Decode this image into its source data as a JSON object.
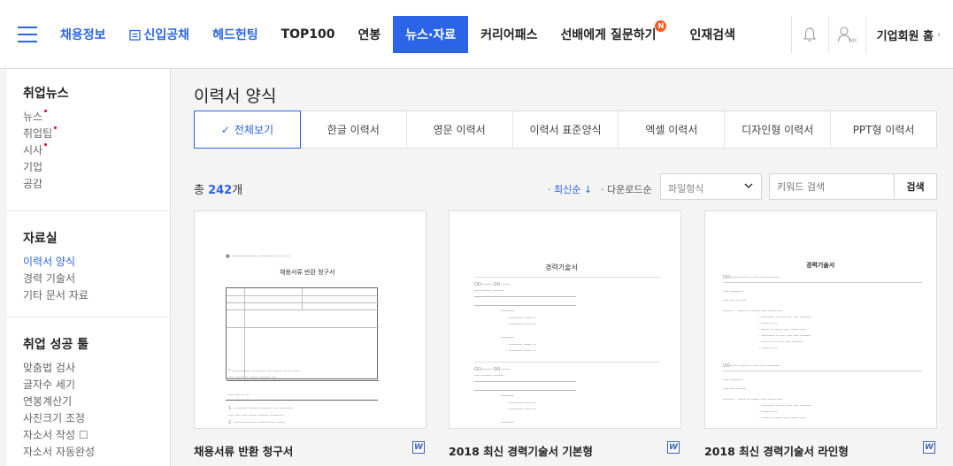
{
  "nav": {
    "items": [
      "채용정보",
      "신입공채",
      "헤드헌팅",
      "TOP100",
      "연봉",
      "뉴스·자료",
      "커리어패스",
      "선배에게 질문하기",
      "인재검색"
    ],
    "new_badge": "N",
    "corp_home": "기업회원 홈"
  },
  "sidebar": {
    "sections": [
      {
        "title": "취업뉴스",
        "items": [
          "뉴스",
          "취업팁",
          "시사",
          "기업",
          "공감"
        ]
      },
      {
        "title": "자료실",
        "items": [
          "이력서 양식",
          "경력 기술서",
          "기타 문서 자료"
        ]
      },
      {
        "title": "취업 성공 툴",
        "items": [
          "맞춤법 검사",
          "글자수 세기",
          "연봉계산기",
          "사진크기 조정",
          "자소서 작성 ☐",
          "자소서 자동완성"
        ]
      }
    ]
  },
  "main": {
    "title": "이력서 양식",
    "tabs": [
      "전체보기",
      "한글 이력서",
      "영문 이력서",
      "이력서 표준양식",
      "엑셀 이력서",
      "디자인형 이력서",
      "PPT형 이력서"
    ],
    "total_prefix": "총 ",
    "total_count": "242",
    "total_suffix": "개",
    "sort_latest": "· 최신순 ↓",
    "sort_download": "· 다운로드순",
    "file_select": "파일형식",
    "search_placeholder": "키워드 검색",
    "search_button": "검색",
    "cards": [
      {
        "title": "채용서류 반환 청구서",
        "doc_title": "채용서류 반환 청구서"
      },
      {
        "title": "2018 최신 경력기술서 기본형",
        "doc_title": "경력기술서"
      },
      {
        "title": "2018 최신 경력기술서 라인형",
        "doc_title": "경력기술서"
      }
    ],
    "file_badge": "W"
  },
  "colors": {
    "accent": "#2a65e8",
    "badge": "#ff5b23",
    "dot": "#e4002b"
  }
}
